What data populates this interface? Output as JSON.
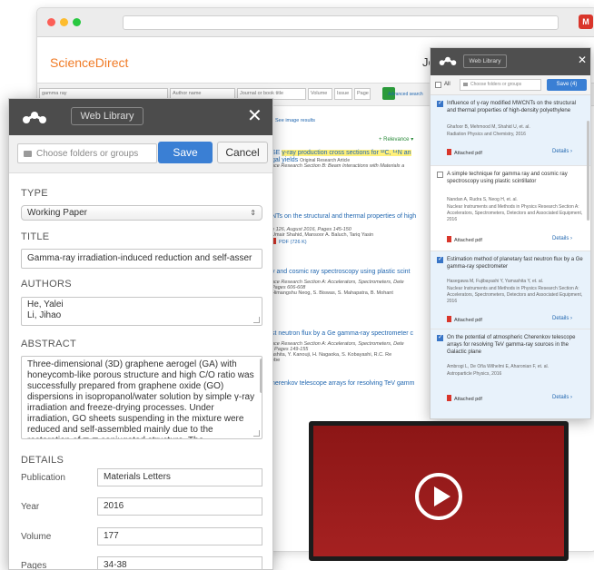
{
  "browser": {
    "site_logo": "ScienceDirect",
    "user_name_partial": "Jo",
    "extension_icon": "M",
    "search": {
      "query": "gamma ray",
      "author_placeholder": "Author name",
      "journal_placeholder": "Journal or book title",
      "volume_placeholder": "Volume",
      "issue_placeholder": "Issue",
      "page_placeholder": "Page",
      "advanced_label": "Advanced search"
    },
    "image_results_label": "See image results",
    "relevance_label": "+ Relevance ▾",
    "results": [
      {
        "title_line": "γ-ray production cross sections for ¹²C, ¹⁴N an",
        "title_prefix": "SE",
        "line2": "gal yields",
        "line2_tag": "Original Research Article",
        "meta": "nce Research Section B: Beam Interactions with Materials a"
      },
      {
        "title_line": "NTs on the structural and thermal properties of high",
        "meta1": "e 126, August 2016, Pages 145-150",
        "meta2": "Umair Shahid, Mansoor A. Baluch, Tariq Yasin",
        "pdf": "PDF (726 K)"
      },
      {
        "title_line": "y and cosmic ray spectroscopy using plastic scint",
        "meta1": "nce Research Section A: Accelerators, Spectrometers, Dete",
        "meta2": "Pages 606-608",
        "meta3": "Himangshu Neog, S. Biswas, S. Mahapatra, B. Mohant"
      },
      {
        "title_line": "st neutron flux by a Ge gamma-ray spectrometer c",
        "meta1": "nce Research Section A: Accelerators, Spectrometers, Dete",
        "meta2": ", Pages 149-155",
        "meta3": "ashita, Y. Kanouji, H. Nagaoka, S. Kobayashi, R.C. Re",
        "meta4": "ebe"
      },
      {
        "title_line": "herenkov telescope arrays for resolving TeV gamm"
      }
    ]
  },
  "web_library_panel": {
    "header_button": "Web Library",
    "select_all_label": "All",
    "folder_placeholder": "Choose folders or groups",
    "save_button": "Save (4)",
    "citations": [
      {
        "selected": true,
        "title": "Influence of γ-ray modified MWCNTs on the structural and thermal properties of high-density polyethylene",
        "authors": "Ghafoor B,  Mehmood M,  Shahid U,  et. al.",
        "source": "Radiation Physics and Chemistry, 2016",
        "pdf": "Attached pdf",
        "details": "Details ›"
      },
      {
        "selected": false,
        "title": "A simple technique for gamma ray and cosmic ray spectroscopy using plastic scintillator",
        "authors": "Nandan A,  Rudra S,  Neog H,  et. al.",
        "source": "Nuclear Instruments and Methods in Physics Research Section A: Accelerators, Spectrometers, Detectors and Associated Equipment, 2016",
        "pdf": "Attached pdf",
        "details": "Details ›"
      },
      {
        "selected": true,
        "title": "Estimation method of planetary fast neutron flux by a Ge gamma-ray spectrometer",
        "authors": "Hasegawa M,  Fujibayashi Y,  Yamashita Y,  et. al.",
        "source": "Nuclear Instruments and Methods in Physics Research Section A: Accelerators, Spectrometers, Detectors and Associated Equipment, 2016",
        "pdf": "Attached pdf",
        "details": "Details ›"
      },
      {
        "selected": true,
        "title": "On the potential of atmospheric Cherenkov telescope arrays for resolving TeV gamma-ray sources in the Galactic plane",
        "authors": "Ambrogi L,  De Oña Wilhelmi E,  Aharonian F,  et. al.",
        "source": "Astroparticle Physics, 2016",
        "pdf": "Attached pdf",
        "details": "Details ›"
      }
    ]
  },
  "importer": {
    "header_button": "Web Library",
    "close_glyph": "✕",
    "folder_placeholder": "Choose folders or groups",
    "save_button": "Save",
    "cancel_button": "Cancel",
    "type_label": "TYPE",
    "type_value": "Working Paper",
    "title_label": "TITLE",
    "title_value": "Gamma-ray irradiation-induced reduction and self-asser",
    "authors_label": "AUTHORS",
    "authors": [
      "He, Yalei",
      "Li, Jihao"
    ],
    "abstract_label": "ABSTRACT",
    "abstract_text": "Three-dimensional (3D) graphene aerogel (GA) with honeycomb-like porous structure and high C/O ratio was successfully prepared from graphene oxide (GO) dispersions in isopropanol/water solution by simple γ-ray irradiation and freeze-drying processes. Under irradiation, GO sheets suspending in the mixture were reduced and self-assembled mainly due to the restoration of π-π conjugated structure. The",
    "details_label": "DETAILS",
    "details": [
      {
        "label": "Publication",
        "value": "Materials Letters"
      },
      {
        "label": "Year",
        "value": "2016"
      },
      {
        "label": "Volume",
        "value": "177"
      },
      {
        "label": "Pages",
        "value": "34-38"
      }
    ]
  },
  "colors": {
    "accent_blue": "#3a7fd4",
    "header_dark": "#4c4c4c",
    "sciencedirect_orange": "#f07b26",
    "video_red": "#9c1b1b"
  }
}
